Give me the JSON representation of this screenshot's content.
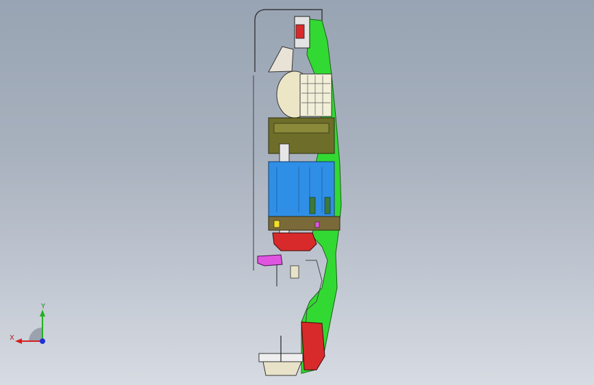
{
  "viewport": {
    "view": "side"
  },
  "triad": {
    "x_label": "X",
    "y_label": "Y",
    "colors": {
      "x": "#d42020",
      "y": "#22b022",
      "z": "#2030d8"
    }
  },
  "model": {
    "part_colors": {
      "frame": "#33d933",
      "motor_housing": "#2f8fe6",
      "heat_sink": "#f2efd8",
      "fan": "#ede6c6",
      "base": "#d82a2a",
      "bracket": "#6e6e2a",
      "clamp": "#e055e0",
      "marker": "#f2e12a"
    }
  }
}
